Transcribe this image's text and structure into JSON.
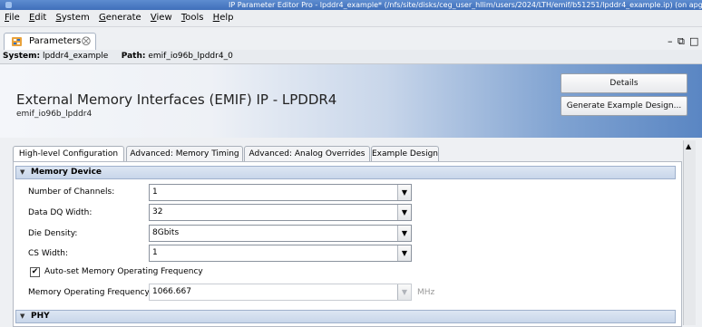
{
  "window": {
    "title": "IP Parameter Editor Pro - lpddr4_example* (/nfs/site/disks/ceg_user_hllim/users/2024/LTH/emif/b51251/lpddr4_example.ip) (on apgc"
  },
  "menu": [
    "File",
    "Edit",
    "System",
    "Generate",
    "View",
    "Tools",
    "Help"
  ],
  "view_tab": {
    "label": "Parameters",
    "close": "⨂"
  },
  "window_controls": {
    "minimize": "–",
    "restore": "⧉",
    "maximize": "□"
  },
  "path_bar": {
    "system_label": "System:",
    "system_value": "lpddr4_example",
    "path_label": "Path:",
    "path_value": "emif_io96b_lpddr4_0"
  },
  "header": {
    "title": "External Memory Interfaces (EMIF) IP - LPDDR4",
    "subtitle": "emif_io96b_lpddr4",
    "details_button": "Details",
    "generate_button": "Generate Example Design..."
  },
  "tabs": [
    "High-level Configuration",
    "Advanced: Memory Timing",
    "Advanced: Analog Overrides",
    "Example Design"
  ],
  "active_tab": "High-level Configuration",
  "sections": {
    "memory_device": {
      "title": "Memory Device",
      "fields": [
        {
          "label": "Number of Channels:",
          "value": "1"
        },
        {
          "label": "Data DQ Width:",
          "value": "32"
        },
        {
          "label": "Die Density:",
          "value": "8Gbits"
        },
        {
          "label": "CS Width:",
          "value": "1"
        }
      ],
      "auto_freq": {
        "label": "Auto-set Memory Operating Frequency",
        "checked": true
      },
      "freq": {
        "label": "Memory Operating Frequency:",
        "value": "1066.667",
        "unit": "MHz",
        "enabled": false
      }
    },
    "phy": {
      "title": "PHY"
    }
  },
  "glyphs": {
    "dropdown": "▼",
    "collapse": "▼",
    "check": "✔",
    "scroll_up": "▲"
  }
}
